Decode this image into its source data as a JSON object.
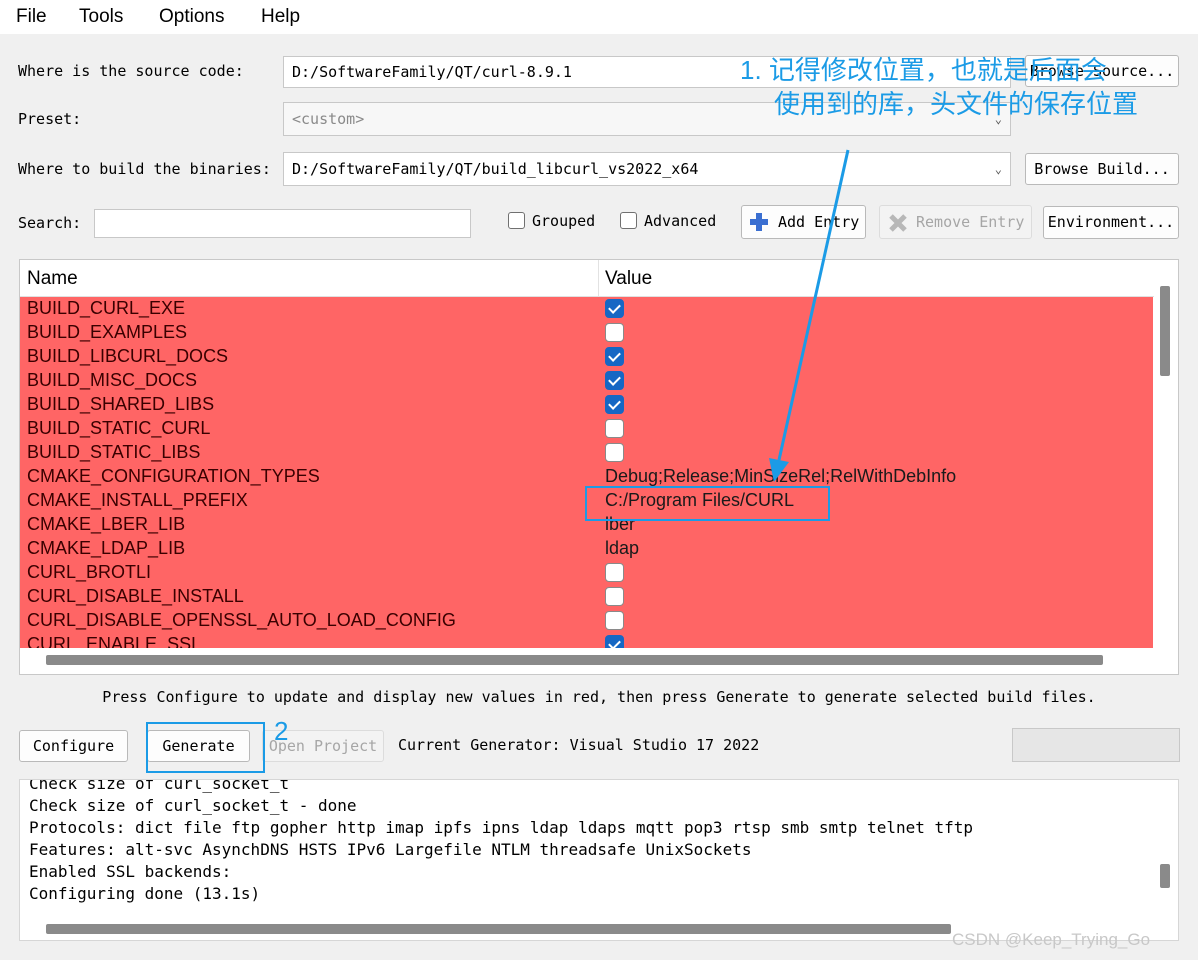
{
  "menu": [
    "File",
    "Tools",
    "Options",
    "Help"
  ],
  "form": {
    "source_label": "Where is the source code:",
    "source_value": "D:/SoftwareFamily/QT/curl-8.9.1",
    "browse_source_label": "Browse Source...",
    "preset_label": "Preset:",
    "preset_value": "<custom>",
    "build_label": "Where to build the binaries:",
    "build_value": "D:/SoftwareFamily/QT/build_libcurl_vs2022_x64",
    "browse_build_label": "Browse Build...",
    "search_label": "Search:",
    "search_value": "",
    "grouped_label": "Grouped",
    "grouped_checked": false,
    "advanced_label": "Advanced",
    "advanced_checked": false,
    "add_entry_label": "Add Entry",
    "remove_entry_label": "Remove Entry",
    "environment_label": "Environment..."
  },
  "table": {
    "headers": [
      "Name",
      "Value"
    ],
    "rows": [
      {
        "name": "BUILD_CURL_EXE",
        "type": "bool",
        "checked": true
      },
      {
        "name": "BUILD_EXAMPLES",
        "type": "bool",
        "checked": false
      },
      {
        "name": "BUILD_LIBCURL_DOCS",
        "type": "bool",
        "checked": true
      },
      {
        "name": "BUILD_MISC_DOCS",
        "type": "bool",
        "checked": true
      },
      {
        "name": "BUILD_SHARED_LIBS",
        "type": "bool",
        "checked": true
      },
      {
        "name": "BUILD_STATIC_CURL",
        "type": "bool",
        "checked": false
      },
      {
        "name": "BUILD_STATIC_LIBS",
        "type": "bool",
        "checked": false
      },
      {
        "name": "CMAKE_CONFIGURATION_TYPES",
        "type": "text",
        "value": "Debug;Release;MinSizeRel;RelWithDebInfo"
      },
      {
        "name": "CMAKE_INSTALL_PREFIX",
        "type": "text",
        "value": "C:/Program Files/CURL"
      },
      {
        "name": "CMAKE_LBER_LIB",
        "type": "text",
        "value": "lber"
      },
      {
        "name": "CMAKE_LDAP_LIB",
        "type": "text",
        "value": "ldap"
      },
      {
        "name": "CURL_BROTLI",
        "type": "bool",
        "checked": false
      },
      {
        "name": "CURL_DISABLE_INSTALL",
        "type": "bool",
        "checked": false
      },
      {
        "name": "CURL_DISABLE_OPENSSL_AUTO_LOAD_CONFIG",
        "type": "bool",
        "checked": false
      },
      {
        "name": "CURL_ENABLE_SSL",
        "type": "bool",
        "checked": true
      }
    ]
  },
  "hint": "Press Configure to update and display new values in red, then press Generate to generate selected build files.",
  "actions": {
    "configure_label": "Configure",
    "generate_label": "Generate",
    "open_project_label": "Open Project",
    "generator_text": "Current Generator: Visual Studio 17 2022"
  },
  "log": [
    "Check size of curl_socket_t",
    "Check size of curl_socket_t - done",
    "Protocols: dict file ftp gopher http imap ipfs ipns ldap ldaps mqtt pop3 rtsp smb smtp telnet tftp",
    "Features: alt-svc AsynchDNS HSTS IPv6 Largefile NTLM threadsafe UnixSockets",
    "Enabled SSL backends:",
    "Configuring done (13.1s)"
  ],
  "annotations": {
    "note1_line1": "1. 记得修改位置，也就是后面会",
    "note1_line2": "使用到的库，头文件的保存位置",
    "note2": "2",
    "color": "#1b9be6"
  },
  "watermark": "CSDN @Keep_Trying_Go",
  "colors": {
    "changed_row": "#ff6565",
    "checkbox_on": "#1667c4"
  }
}
